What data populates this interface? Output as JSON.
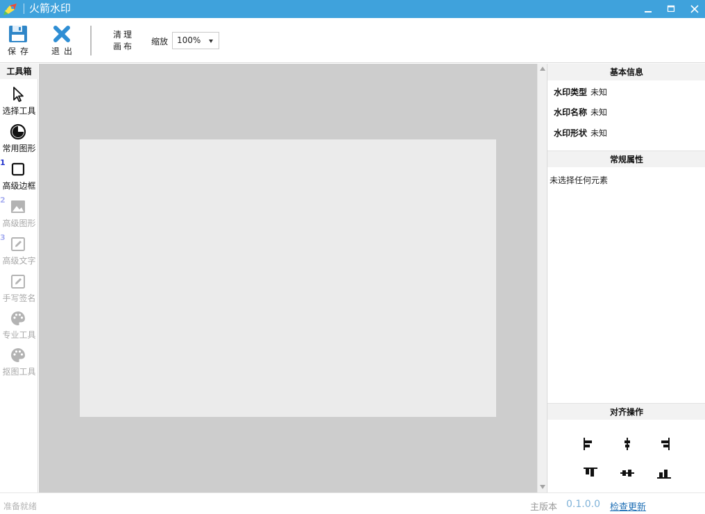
{
  "app": {
    "title": "火箭水印",
    "logo_icon": "rocket-logo-icon",
    "accent_color": "#3fa2dc"
  },
  "window_controls": {
    "minimize_icon": "minimize-icon",
    "maximize_icon": "maximize-icon",
    "close_icon": "close-icon"
  },
  "toolbar": {
    "save_label": "保存",
    "exit_label": "退出",
    "clear_label_line1": "清理",
    "clear_label_line2": "画布",
    "zoom_label": "缩放",
    "zoom_value": "100%"
  },
  "toolbox": {
    "title": "工具箱",
    "tools": [
      {
        "label": "选择工具",
        "icon": "cursor-arrow-icon",
        "number": "",
        "enabled": true
      },
      {
        "label": "常用图形",
        "icon": "shape-circle-icon",
        "number": "",
        "enabled": true
      },
      {
        "label": "高级边框",
        "icon": "square-border-icon",
        "number": "1",
        "enabled": true
      },
      {
        "label": "高级图形",
        "icon": "image-icon",
        "number": "2",
        "enabled": false
      },
      {
        "label": "高级文字",
        "icon": "edit-text-icon",
        "number": "3",
        "enabled": false
      },
      {
        "label": "手写签名",
        "icon": "signature-pen-icon",
        "number": "",
        "enabled": false
      },
      {
        "label": "专业工具",
        "icon": "palette-icon",
        "number": "",
        "enabled": false
      },
      {
        "label": "抠图工具",
        "icon": "palette-icon",
        "number": "",
        "enabled": false
      }
    ]
  },
  "right_panel": {
    "basic_info": {
      "header": "基本信息",
      "rows": [
        {
          "key": "水印类型",
          "value": "未知"
        },
        {
          "key": "水印名称",
          "value": "未知"
        },
        {
          "key": "水印形状",
          "value": "未知"
        }
      ]
    },
    "general_props": {
      "header": "常规属性",
      "empty_text": "未选择任何元素"
    },
    "align": {
      "header": "对齐操作",
      "buttons": [
        "align-left-icon",
        "align-center-horizontal-icon",
        "align-right-icon",
        "align-top-icon",
        "align-middle-vertical-icon",
        "align-bottom-icon"
      ]
    }
  },
  "statusbar": {
    "ready_text": "准备就绪",
    "version_label": "主版本",
    "version_value": "0.1.0.0",
    "check_update": "检查更新"
  }
}
